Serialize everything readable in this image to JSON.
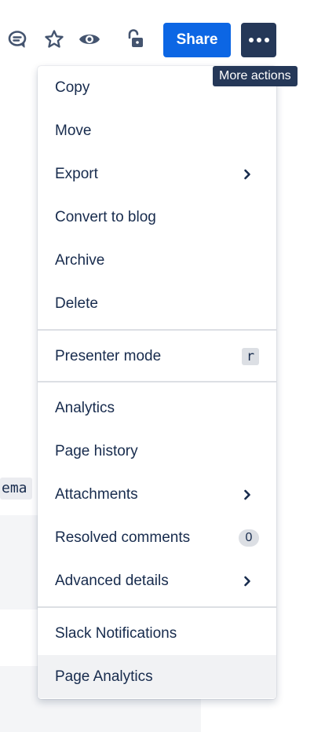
{
  "toolbar": {
    "share_label": "Share",
    "more_tooltip": "More actions",
    "icons": [
      "comment-icon",
      "star-icon",
      "watch-icon",
      "unlock-icon",
      "more-icon"
    ]
  },
  "background": {
    "code_fragment": "ema"
  },
  "menu": {
    "section1": [
      {
        "label": "Copy"
      },
      {
        "label": "Move"
      },
      {
        "label": "Export",
        "submenu": true
      },
      {
        "label": "Convert to blog"
      },
      {
        "label": "Archive"
      },
      {
        "label": "Delete"
      }
    ],
    "section2": [
      {
        "label": "Presenter mode",
        "shortcut": "r"
      }
    ],
    "section3": [
      {
        "label": "Analytics"
      },
      {
        "label": "Page history"
      },
      {
        "label": "Attachments",
        "submenu": true
      },
      {
        "label": "Resolved comments",
        "count": "0"
      },
      {
        "label": "Advanced details",
        "submenu": true
      }
    ],
    "section4": [
      {
        "label": "Slack Notifications"
      },
      {
        "label": "Page Analytics",
        "hovered": true
      }
    ]
  },
  "colors": {
    "share_button": "#0c66e4",
    "more_button": "#253858",
    "hover_row": "#f1f2f4"
  }
}
